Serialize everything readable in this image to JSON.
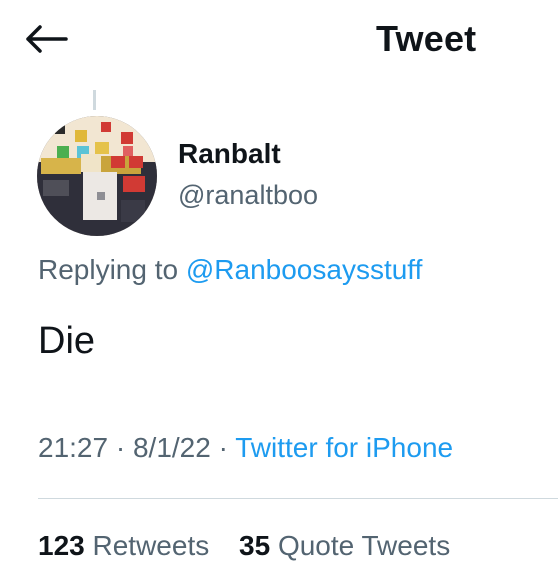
{
  "header": {
    "back_icon": "arrow-left-icon",
    "title": "Tweet"
  },
  "tweet": {
    "display_name": "Ranbalt",
    "handle": "@ranaltboo",
    "replying_prefix": "Replying to",
    "replying_to": "@Ranboosaysstuff",
    "text": "Die",
    "time": "21:27",
    "date": "8/1/22",
    "source": "Twitter for iPhone",
    "separator": "·"
  },
  "stats": {
    "retweets_count": "123",
    "retweets_label": "Retweets",
    "quote_tweets_count": "35",
    "quote_tweets_label": "Quote Tweets"
  },
  "colors": {
    "link": "#1d9bf0",
    "secondary_text": "#536471",
    "primary_text": "#0f1419",
    "divider": "#cfd9de"
  }
}
